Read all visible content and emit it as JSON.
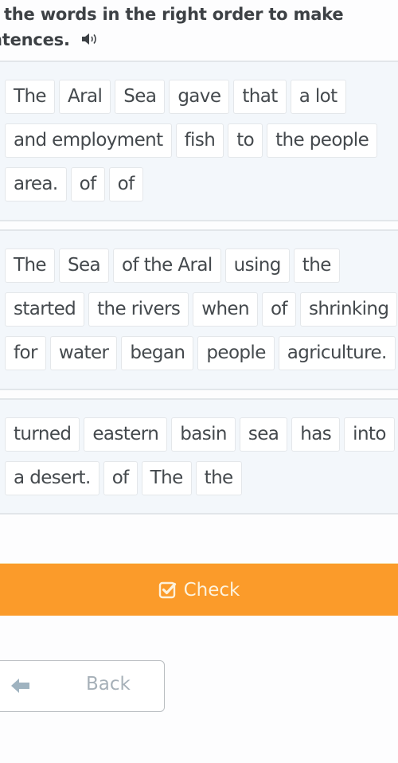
{
  "instructions": {
    "line1": "t the words in the right order to make",
    "line2": "ntences.",
    "audio_icon": "speaker-icon"
  },
  "sentences": [
    {
      "rows": [
        [
          "The",
          "Aral",
          "Sea",
          "gave",
          "that",
          "a lot"
        ],
        [
          "and employment",
          "fish",
          "to",
          "the people"
        ],
        [
          "area.",
          "of",
          "of"
        ]
      ]
    },
    {
      "rows": [
        [
          "The",
          "Sea",
          "of the Aral",
          "using",
          "the"
        ],
        [
          "started",
          "the rivers",
          "when",
          "of",
          "shrinking"
        ],
        [
          "for",
          "water",
          "began",
          "people",
          "agriculture."
        ]
      ]
    },
    {
      "rows": [
        [
          "turned",
          "eastern",
          "basin",
          "sea",
          "has",
          "into"
        ],
        [
          "a desert.",
          "of",
          "The",
          "the"
        ]
      ]
    }
  ],
  "actions": {
    "check_label": "Check",
    "check_icon": "checkbox-checked-icon",
    "back_label": "Back",
    "back_icon": "arrow-left-icon"
  },
  "colors": {
    "accent": "#fb9b2a",
    "panel_bg": "#f3f7fb",
    "tile_bg": "#ffffff"
  }
}
